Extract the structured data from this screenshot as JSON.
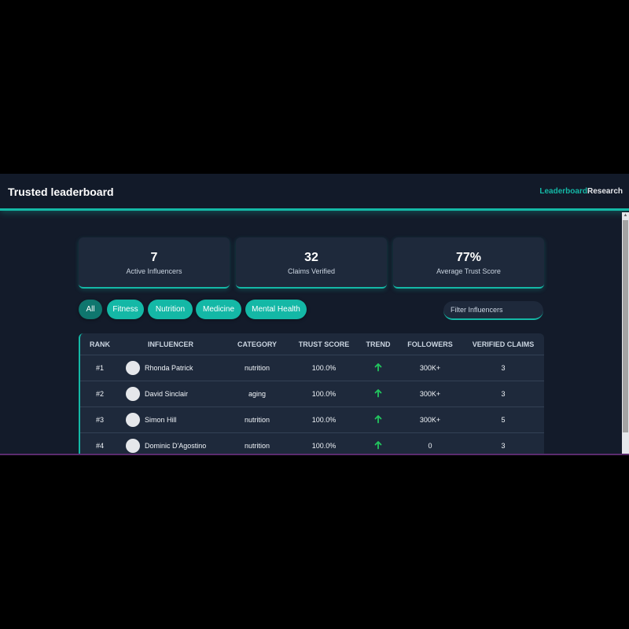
{
  "header": {
    "title": "Trusted leaderboard",
    "nav": [
      "Leaderboard",
      "Research"
    ]
  },
  "stats": [
    {
      "value": "7",
      "label": "Active Influencers"
    },
    {
      "value": "32",
      "label": "Claims Verified"
    },
    {
      "value": "77%",
      "label": "Average Trust Score"
    }
  ],
  "filters": {
    "chips": [
      "All",
      "Fitness",
      "Nutrition",
      "Medicine",
      "Mental Health"
    ],
    "active": "All",
    "search_placeholder": "Filter Influencers"
  },
  "table": {
    "columns": [
      "RANK",
      "INFLUENCER",
      "CATEGORY",
      "TRUST SCORE",
      "TREND",
      "FOLLOWERS",
      "VERIFIED CLAIMS"
    ],
    "rows": [
      {
        "rank": "#1",
        "name": "Rhonda Patrick",
        "category": "nutrition",
        "trust": "100.0%",
        "trend": "up",
        "followers": "300K+",
        "claims": "3"
      },
      {
        "rank": "#2",
        "name": "David Sinclair",
        "category": "aging",
        "trust": "100.0%",
        "trend": "up",
        "followers": "300K+",
        "claims": "3"
      },
      {
        "rank": "#3",
        "name": "Simon Hill",
        "category": "nutrition",
        "trust": "100.0%",
        "trend": "up",
        "followers": "300K+",
        "claims": "5"
      },
      {
        "rank": "#4",
        "name": "Dominic D'Agostino",
        "category": "nutrition",
        "trust": "100.0%",
        "trend": "up",
        "followers": "0",
        "claims": "3"
      }
    ]
  },
  "colors": {
    "accent": "#14b8a6",
    "accent_dark": "#0f766e",
    "background": "#131b2a",
    "card": "#1e293b",
    "trend_up": "#22c55e"
  }
}
